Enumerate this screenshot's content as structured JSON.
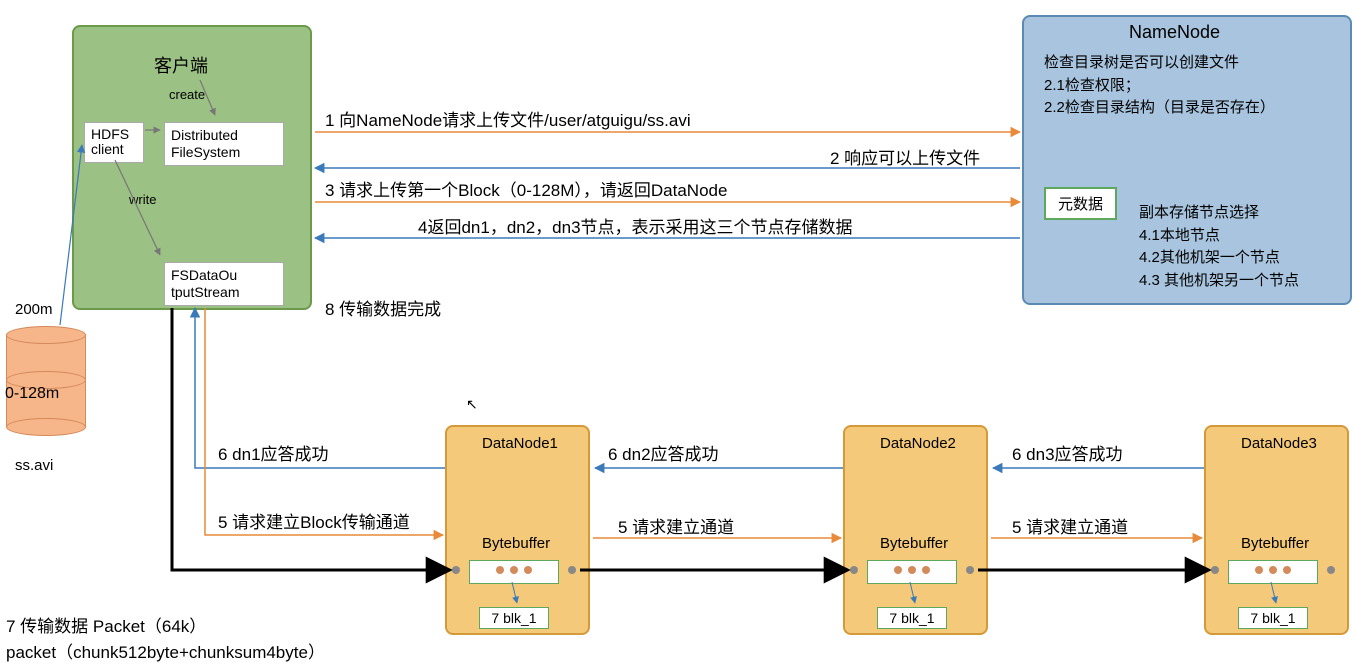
{
  "client": {
    "title": "客户端",
    "create": "create",
    "write": "write",
    "hdfs": "HDFS client",
    "dfs": "Distributed FileSystem",
    "fsdos": "FSDataOu tputStream"
  },
  "file": {
    "size200": "200m",
    "range": "0-128m",
    "name": "ss.avi"
  },
  "namenode": {
    "title": "NameNode",
    "check1": "检查目录树是否可以创建文件",
    "check2": "2.1检查权限；",
    "check3": "2.2检查目录结构（目录是否存在）",
    "meta": "元数据",
    "replica_title": "副本存储节点选择",
    "replica1": "4.1本地节点",
    "replica2": "4.2其他机架一个节点",
    "replica3": "4.3 其他机架另一个节点"
  },
  "steps": {
    "s1": "1 向NameNode请求上传文件/user/atguigu/ss.avi",
    "s2": "2 响应可以上传文件",
    "s3": "3 请求上传第一个Block（0-128M），请返回DataNode",
    "s4": "4返回dn1，dn2，dn3节点，表示采用这三个节点存储数据",
    "s8": "8 传输数据完成",
    "s6dn1": "6 dn1应答成功",
    "s6dn2": "6 dn2应答成功",
    "s6dn3": "6 dn3应答成功",
    "s5block": "5 请求建立Block传输通道",
    "s5ch": "5 请求建立通道",
    "s7": "7 传输数据 Packet（64k）",
    "packet": "packet（chunk512byte+chunksum4byte）"
  },
  "datanodes": {
    "dn1": "DataNode1",
    "dn2": "DataNode2",
    "dn3": "DataNode3",
    "bytebuffer": "Bytebuffer",
    "blk": "7 blk_1"
  }
}
